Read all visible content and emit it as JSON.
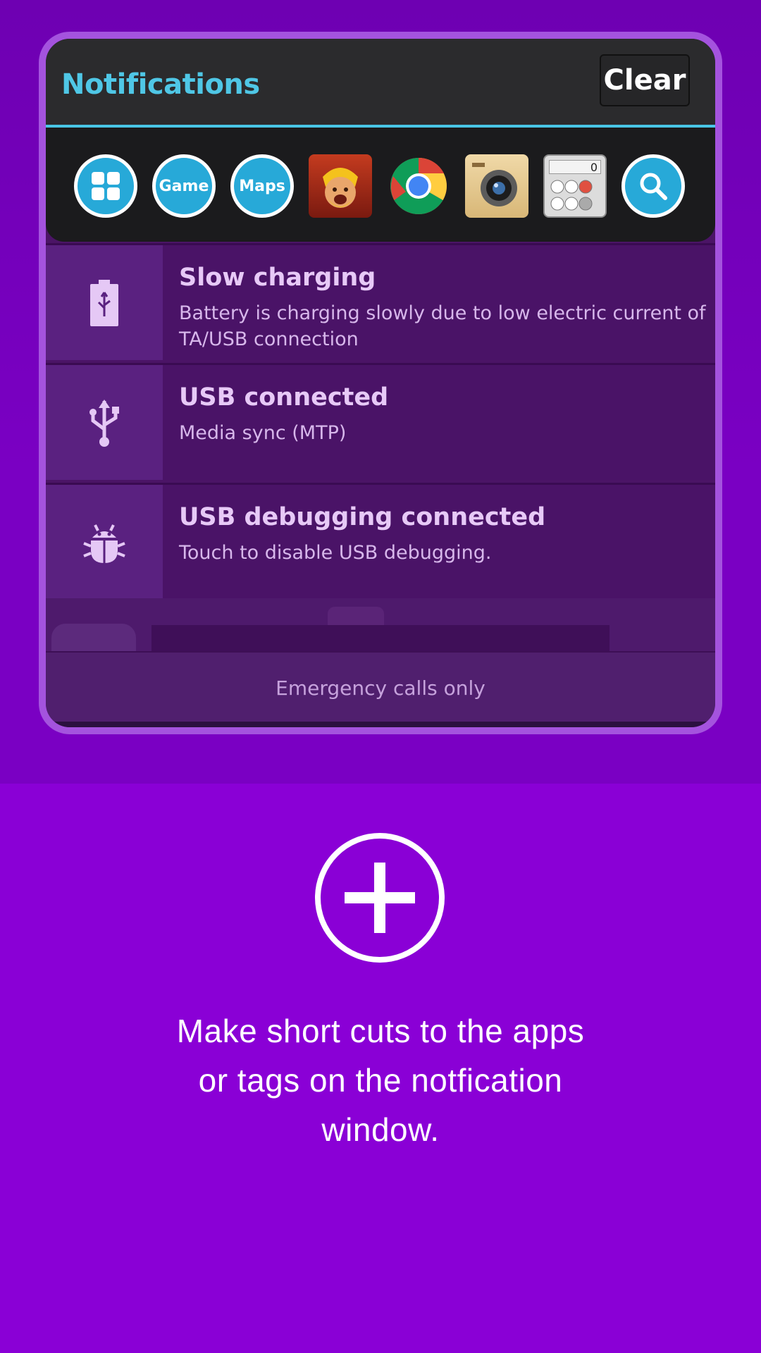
{
  "header": {
    "title": "Notifications",
    "clear_label": "Clear"
  },
  "shortcuts": [
    {
      "name": "apps-grid-shortcut",
      "label": ""
    },
    {
      "name": "game-tag-shortcut",
      "label": "Game"
    },
    {
      "name": "maps-tag-shortcut",
      "label": "Maps"
    },
    {
      "name": "clash-of-clans-app",
      "label": ""
    },
    {
      "name": "chrome-app",
      "label": ""
    },
    {
      "name": "camera-app",
      "label": ""
    },
    {
      "name": "calculator-app",
      "label": "0"
    },
    {
      "name": "search-shortcut",
      "label": ""
    }
  ],
  "notifications": [
    {
      "icon": "battery-usb-icon",
      "title": "Slow charging",
      "text": "Battery is charging slowly due to low electric current of TA/USB connection"
    },
    {
      "icon": "usb-icon",
      "title": "USB connected",
      "text": "Media sync (MTP)"
    },
    {
      "icon": "android-bug-icon",
      "title": "USB debugging connected",
      "text": "Touch to disable USB debugging."
    }
  ],
  "status": {
    "emergency": "Emergency calls only"
  },
  "caption": {
    "line1": "Make short cuts to the apps",
    "line2": "or tags on the notfication",
    "line3": "window."
  },
  "colors": {
    "accent": "#4fc7e6",
    "frame": "#a453de",
    "background": "#8a00d6"
  }
}
